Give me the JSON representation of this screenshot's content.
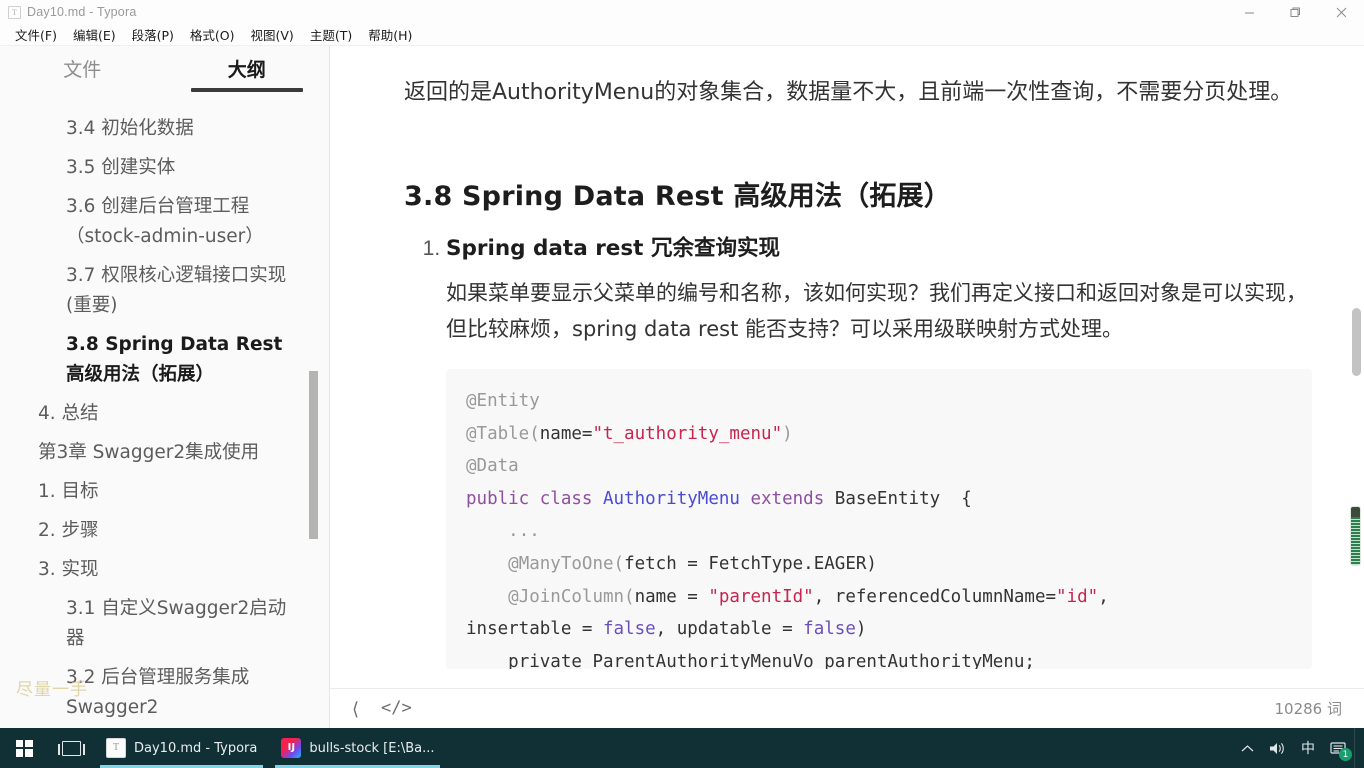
{
  "window": {
    "title": "Day10.md - Typora",
    "app_icon": "T",
    "controls": {
      "minimize": "minimize-icon",
      "maximize": "maximize-icon",
      "close": "close-icon"
    }
  },
  "menubar": {
    "items": [
      {
        "label": "文件(F)",
        "key": "F"
      },
      {
        "label": "编辑(E)",
        "key": "E"
      },
      {
        "label": "段落(P)",
        "key": "P"
      },
      {
        "label": "格式(O)",
        "key": "O"
      },
      {
        "label": "视图(V)",
        "key": "V"
      },
      {
        "label": "主题(T)",
        "key": "T"
      },
      {
        "label": "帮助(H)",
        "key": "H"
      }
    ]
  },
  "sidebar": {
    "tabs": [
      {
        "label": "文件",
        "active": false
      },
      {
        "label": "大纲",
        "active": true
      }
    ],
    "outline": [
      {
        "label": "3.4 初始化数据",
        "level": 3,
        "active": false
      },
      {
        "label": "3.5 创建实体",
        "level": 3,
        "active": false
      },
      {
        "label": "3.6 创建后台管理工程（stock-admin-user）",
        "level": 3,
        "active": false
      },
      {
        "label": "3.7 权限核心逻辑接口实现 (重要)",
        "level": 3,
        "active": false
      },
      {
        "label": "3.8 Spring Data Rest 高级用法（拓展）",
        "level": 3,
        "active": true
      },
      {
        "label": "4. 总结",
        "level": 2,
        "active": false
      },
      {
        "label": "第3章 Swagger2集成使用",
        "level": 2,
        "active": false
      },
      {
        "label": "1. 目标",
        "level": 2,
        "active": false
      },
      {
        "label": "2. 步骤",
        "level": 2,
        "active": false
      },
      {
        "label": "3. 实现",
        "level": 2,
        "active": false
      },
      {
        "label": "3.1 自定义Swagger2启动器",
        "level": 3,
        "active": false
      },
      {
        "label": "3.2 后台管理服务集成Swagger2",
        "level": 3,
        "active": false
      }
    ],
    "watermark": "尽量一手"
  },
  "document": {
    "intro_paragraph": "返回的是AuthorityMenu的对象集合，数据量不大，且前端一次性查询，不需要分页处理。",
    "section_heading": "3.8 Spring Data Rest 高级用法（拓展）",
    "list_item_heading": "Spring data rest 冗余查询实现",
    "list_item_paragraph": "如果菜单要显示父菜单的编号和名称，该如何实现？我们再定义接口和返回对象是可以实现，但比较麻烦，spring data rest 能否支持？可以采用级联映射方式处理。",
    "code_lines": [
      [
        {
          "t": "@Entity",
          "c": "ann"
        }
      ],
      [
        {
          "t": "@Table(",
          "c": "ann"
        },
        {
          "t": "name=",
          "c": "plain"
        },
        {
          "t": "\"t_authority_menu\"",
          "c": "str"
        },
        {
          "t": ")",
          "c": "ann"
        }
      ],
      [
        {
          "t": "@Data",
          "c": "ann"
        }
      ],
      [
        {
          "t": "public class ",
          "c": "kw"
        },
        {
          "t": "AuthorityMenu ",
          "c": "cls"
        },
        {
          "t": "extends ",
          "c": "kw"
        },
        {
          "t": "BaseEntity  {",
          "c": "plain"
        }
      ],
      [
        {
          "t": "    ...",
          "c": "ann"
        }
      ],
      [
        {
          "t": "    @ManyToOne(",
          "c": "ann"
        },
        {
          "t": "fetch = FetchType.EAGER)",
          "c": "plain"
        }
      ],
      [
        {
          "t": "    @JoinColumn(",
          "c": "ann"
        },
        {
          "t": "name = ",
          "c": "plain"
        },
        {
          "t": "\"parentId\"",
          "c": "str"
        },
        {
          "t": ", referencedColumnName=",
          "c": "plain"
        },
        {
          "t": "\"id\"",
          "c": "str"
        },
        {
          "t": ",",
          "c": "plain"
        }
      ],
      [
        {
          "t": "insertable = ",
          "c": "plain"
        },
        {
          "t": "false",
          "c": "const"
        },
        {
          "t": ", updatable = ",
          "c": "plain"
        },
        {
          "t": "false",
          "c": "const"
        },
        {
          "t": ")",
          "c": "plain"
        }
      ],
      [
        {
          "t": "    private ParentAuthorityMenuVo parentAuthorityMenu;",
          "c": "plain"
        }
      ]
    ]
  },
  "statusbar": {
    "back_icon": "chevron-left-icon",
    "source_icon": "</>",
    "word_count": "10286 词"
  },
  "taskbar": {
    "start": "windows-logo-icon",
    "task_view": "task-view-icon",
    "apps": [
      {
        "label": "Day10.md - Typora",
        "icon": "T",
        "active": true
      },
      {
        "label": "bulls-stock [E:\\Ba...",
        "icon": "IJ",
        "active": true
      }
    ],
    "tray": {
      "chevron": "︿",
      "volume": "volume-icon",
      "ime": "中",
      "notifications_badge": "1"
    }
  },
  "colors": {
    "accent": "#3a3a3a",
    "taskbar_bg": "#113036",
    "code_bg": "#f8f8f8",
    "string_token": "#c7254e",
    "keyword_token": "#8f4fa0",
    "class_token": "#4a4ad6"
  }
}
